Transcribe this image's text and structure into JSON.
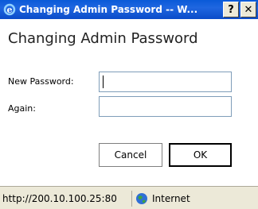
{
  "window": {
    "title": "Changing Admin Password -- W...",
    "help_glyph": "?",
    "close_glyph": "✕"
  },
  "page": {
    "heading": "Changing Admin Password",
    "new_password_label": "New Password:",
    "new_password_value": "",
    "again_label": "Again:",
    "again_value": "",
    "cancel_label": "Cancel",
    "ok_label": "OK"
  },
  "statusbar": {
    "url": "http://200.10.100.25:80",
    "zone": "Internet"
  },
  "colors": {
    "titlebar": "#0a5ad8",
    "statusbar": "#ece9d8",
    "field_border": "#7f9db9"
  }
}
